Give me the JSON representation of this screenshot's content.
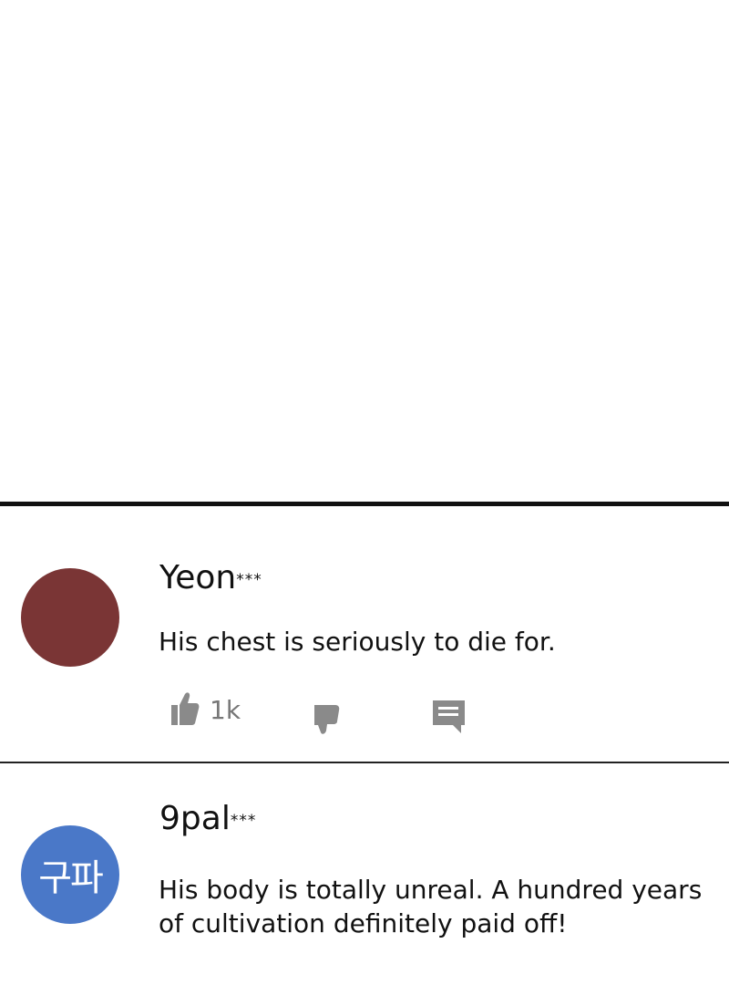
{
  "comments": [
    {
      "username": "Yeon",
      "masked_suffix": "***",
      "avatar_text": "",
      "avatar_color": "#7a3535",
      "text": "His chest is seriously to die for.",
      "like_count": "1k",
      "icons": {
        "like": "thumbs-up-icon",
        "dislike": "thumbs-down-icon",
        "reply": "comment-icon"
      }
    },
    {
      "username": "9pal",
      "masked_suffix": "***",
      "avatar_text": "구파",
      "avatar_color": "#4a78c8",
      "text": "His body is totally unreal. A hundred years of cultivation definitely paid off!"
    }
  ],
  "colors": {
    "divider": "#111111",
    "icon_gray": "#8a8a8a",
    "count_text": "#777777"
  }
}
